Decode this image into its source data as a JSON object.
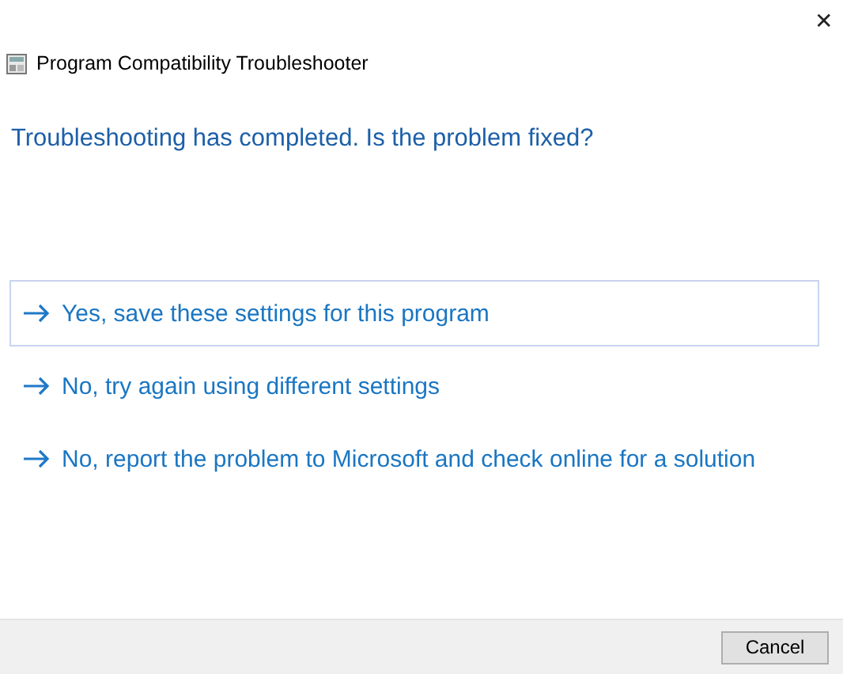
{
  "window": {
    "title": "Program Compatibility Troubleshooter",
    "close": "✕"
  },
  "heading": "Troubleshooting has completed.  Is the problem fixed?",
  "options": [
    {
      "label": "Yes, save these settings for this program",
      "selected": true
    },
    {
      "label": "No, try again using different settings",
      "selected": false
    },
    {
      "label": "No, report the problem to Microsoft and check online for a solution",
      "selected": false
    }
  ],
  "buttons": [
    "Cancel"
  ]
}
